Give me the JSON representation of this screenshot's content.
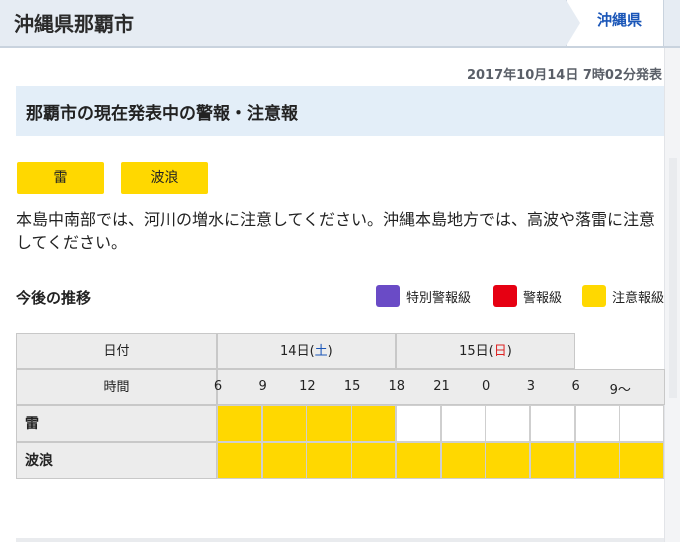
{
  "header": {
    "title": "沖縄県那覇市",
    "prefecture_tab": "沖縄県"
  },
  "issued_at": "2017年10月14日 7時02分発表",
  "section_title": "那覇市の現在発表中の警報・注意報",
  "badges": [
    "雷",
    "波浪"
  ],
  "description": "本島中南部では、河川の増水に注意してください。沖縄本島地方では、高波や落雷に注意してください。",
  "trend": {
    "title": "今後の推移",
    "legend": [
      {
        "label": "特別警報級",
        "color": "#6a4bc6"
      },
      {
        "label": "警報級",
        "color": "#e60012"
      },
      {
        "label": "注意報級",
        "color": "#ffd800"
      }
    ]
  },
  "table": {
    "date_header": "日付",
    "time_header": "時間",
    "days": [
      {
        "day": "14日(",
        "dow": "土",
        "close": ")",
        "span": 4
      },
      {
        "day": "15日(",
        "dow": "日",
        "close": ")",
        "span": 4
      }
    ],
    "times": [
      "6",
      "9",
      "12",
      "15",
      "18",
      "21",
      "0",
      "3",
      "6",
      "9〜"
    ],
    "rows": [
      {
        "name": "雷",
        "levels": [
          "advisory",
          "advisory",
          "advisory",
          "advisory",
          "none",
          "none",
          "none",
          "none",
          "none",
          "none"
        ]
      },
      {
        "name": "波浪",
        "levels": [
          "advisory",
          "advisory",
          "advisory",
          "advisory",
          "advisory",
          "advisory",
          "advisory",
          "advisory",
          "advisory",
          "advisory"
        ]
      }
    ]
  }
}
